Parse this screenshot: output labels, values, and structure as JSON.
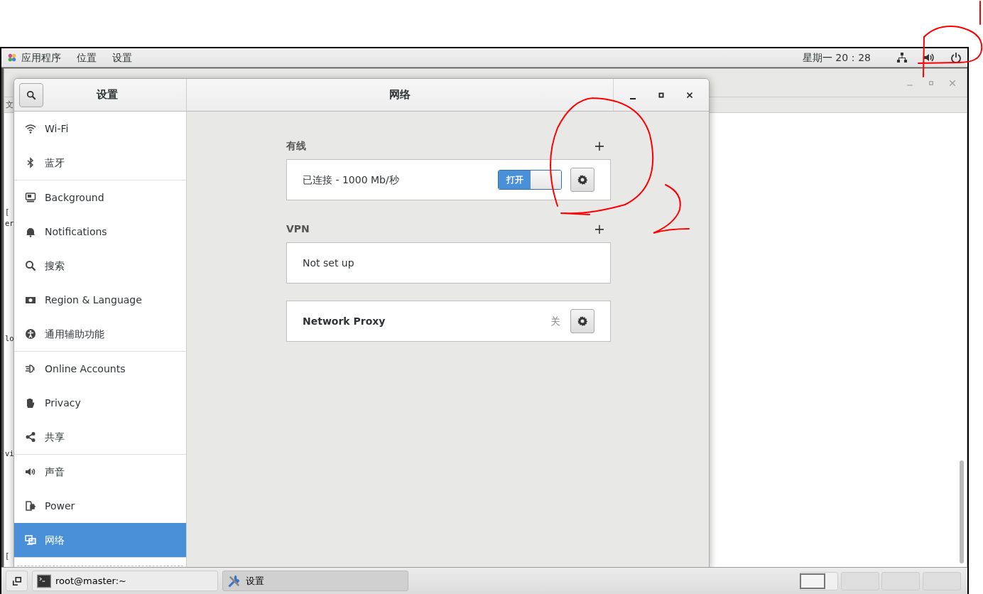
{
  "top_panel": {
    "menus": [
      {
        "label": "应用程序"
      },
      {
        "label": "位置"
      },
      {
        "label": "设置"
      }
    ],
    "clock": "星期一 20：28"
  },
  "terminal": {
    "menu_partial": "文",
    "lines": [
      "[",
      "er",
      "lo",
      "vi",
      "["
    ]
  },
  "settings": {
    "sidebar_title": "设置",
    "title": "网络",
    "sidebar": [
      [
        {
          "label": "Wi-Fi",
          "selected": false
        },
        {
          "label": "蓝牙",
          "selected": false
        }
      ],
      [
        {
          "label": "Background",
          "selected": false
        },
        {
          "label": "Notifications",
          "selected": false
        },
        {
          "label": "搜索",
          "selected": false
        },
        {
          "label": "Region & Language",
          "selected": false
        },
        {
          "label": "通用辅助功能",
          "selected": false
        }
      ],
      [
        {
          "label": "Online Accounts",
          "selected": false
        },
        {
          "label": "Privacy",
          "selected": false
        },
        {
          "label": "共享",
          "selected": false
        }
      ],
      [
        {
          "label": "声音",
          "selected": false
        },
        {
          "label": "Power",
          "selected": false
        },
        {
          "label": "网络",
          "selected": true
        }
      ]
    ],
    "wired": {
      "heading": "有线",
      "add": "+",
      "status": "已连接 - 1000 Mb/秒",
      "switch": {
        "label": "打开",
        "on": true
      }
    },
    "vpn": {
      "heading": "VPN",
      "add": "+",
      "status": "Not set up"
    },
    "proxy": {
      "label": "Network Proxy",
      "status": "关"
    }
  },
  "taskbar": {
    "tasks": [
      {
        "label": "root@master:~",
        "selected": false
      },
      {
        "label": "设置",
        "selected": true
      }
    ],
    "workspaces": [
      {
        "selected": true
      },
      {
        "selected": false
      },
      {
        "selected": false
      },
      {
        "selected": false
      }
    ]
  }
}
